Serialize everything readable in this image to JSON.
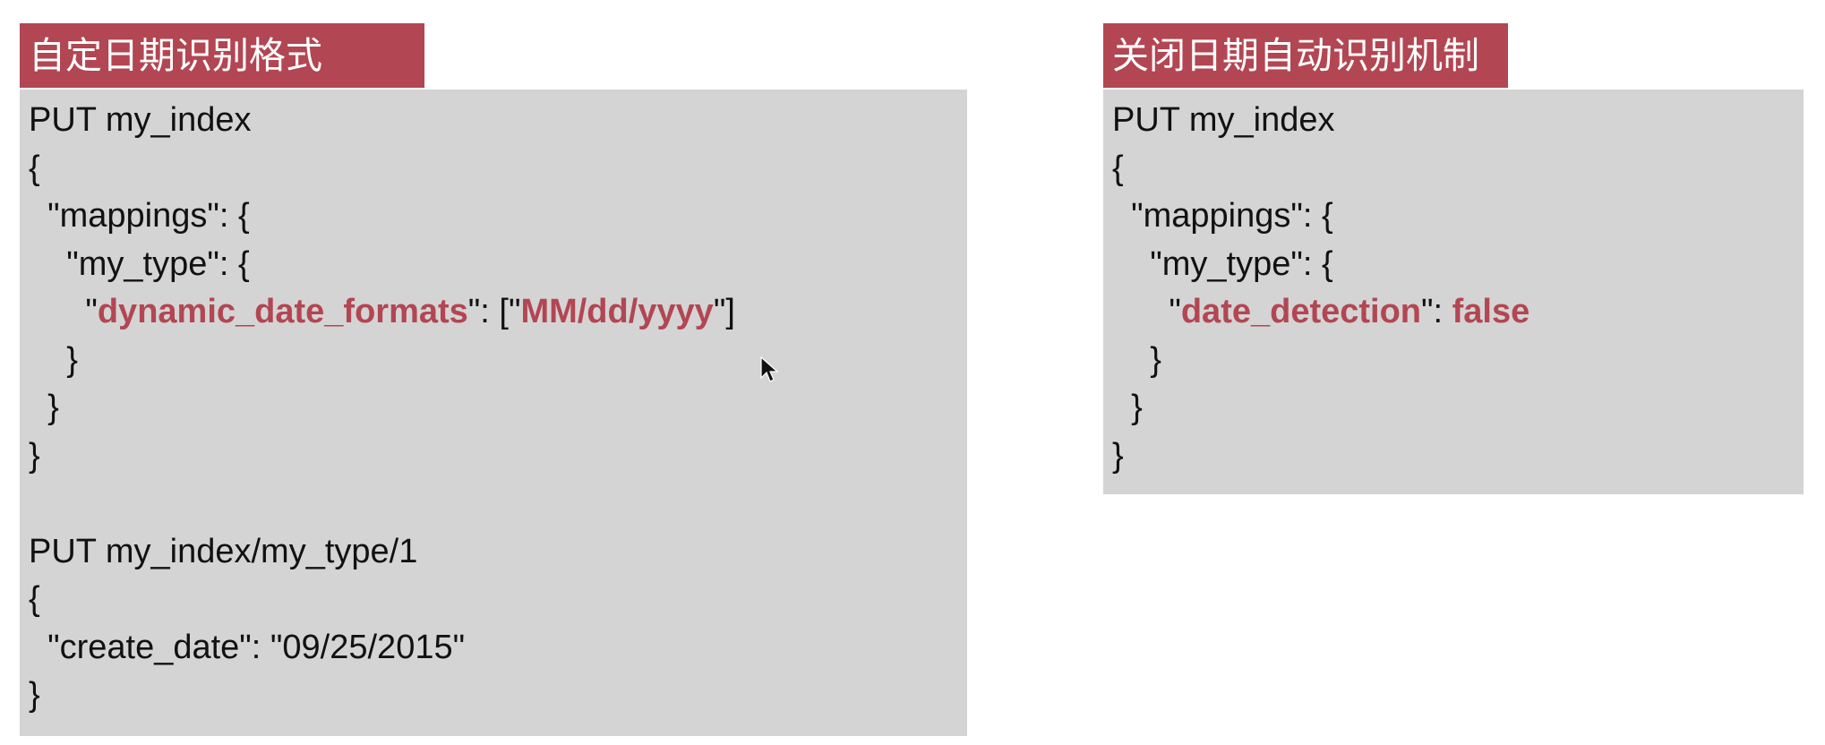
{
  "left_panel": {
    "title": "自定日期识别格式",
    "lines": {
      "l1": "PUT my_index",
      "l2": "{",
      "l3": "  \"mappings\": {",
      "l4": "    \"my_type\": {",
      "l5_pre": "      \"",
      "l5_key": "dynamic_date_formats",
      "l5_mid": "\": [\"",
      "l5_val": "MM/dd/yyyy",
      "l5_post": "\"]",
      "l6": "    }",
      "l7": "  }",
      "l8": "}",
      "l9": " ",
      "l10": "PUT my_index/my_type/1",
      "l11": "{",
      "l12": "  \"create_date\": \"09/25/2015\"",
      "l13": "}"
    }
  },
  "right_panel": {
    "title": "关闭日期自动识别机制",
    "lines": {
      "l1": "PUT my_index",
      "l2": "{",
      "l3": "  \"mappings\": {",
      "l4": "    \"my_type\": {",
      "l5_pre": "      \"",
      "l5_key": "date_detection",
      "l5_mid": "\": ",
      "l5_val": "false",
      "l6": "    }",
      "l7": "  }",
      "l8": "}"
    }
  },
  "colors": {
    "accent": "#b24652",
    "code_background": "#d4d4d4",
    "text": "#111111"
  },
  "icons": {
    "cursor": "mouse-pointer-icon"
  }
}
